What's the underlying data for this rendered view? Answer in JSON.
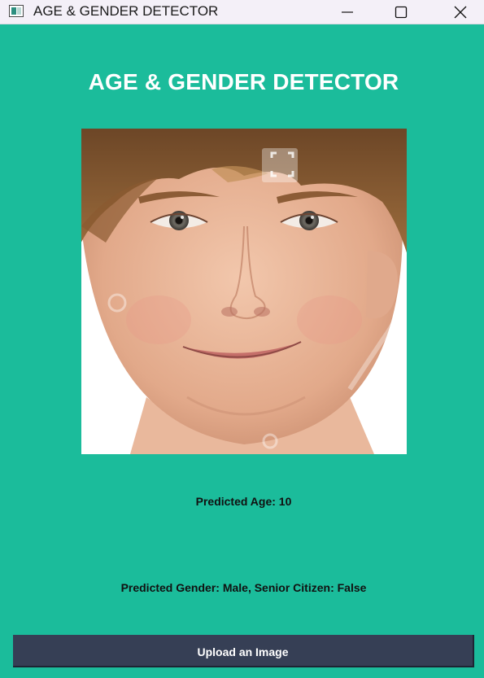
{
  "window": {
    "title": "AGE & GENDER DETECTOR",
    "controls": [
      "minimize-icon",
      "maximize-icon",
      "close-icon"
    ]
  },
  "main": {
    "heading": "AGE & GENDER DETECTOR",
    "image": {
      "subject": "child face photo",
      "icon": "face-portrait"
    },
    "predicted_age": "Predicted Age: 10",
    "predicted_gender": "Predicted Gender: Male, Senior Citizen: False",
    "upload_button_label": "Upload an Image"
  },
  "colors": {
    "background": "#1bbc9b",
    "titlebar": "#f4f0f8",
    "button": "#363f55",
    "heading_text": "#ffffff"
  }
}
